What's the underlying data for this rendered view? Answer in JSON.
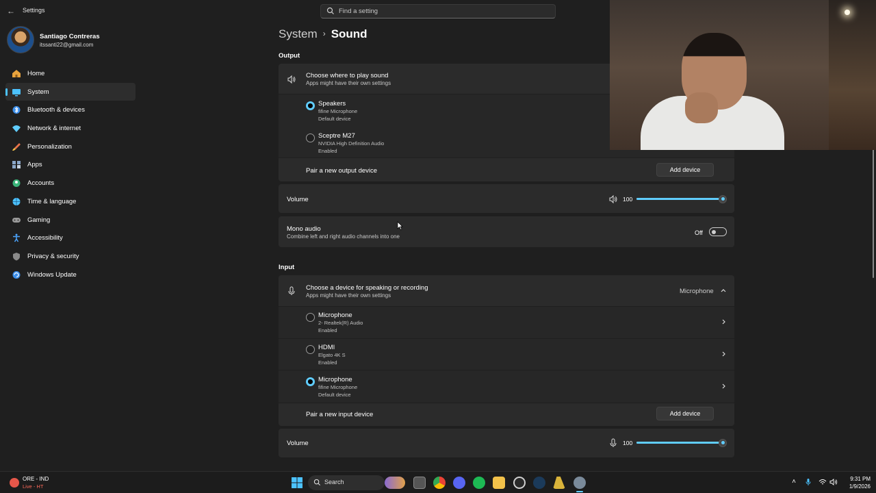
{
  "app": {
    "title": "Settings"
  },
  "search": {
    "placeholder": "Find a setting"
  },
  "profile": {
    "name": "Santiago Contreras",
    "email": "itssanti22@gmail.com"
  },
  "sidebar": {
    "items": [
      {
        "label": "Home",
        "icon": "home-icon",
        "color": "#e8a33d"
      },
      {
        "label": "System",
        "icon": "system-icon",
        "color": "#4cc2ff",
        "active": true
      },
      {
        "label": "Bluetooth & devices",
        "icon": "bluetooth-icon",
        "color": "#3b8eea"
      },
      {
        "label": "Network & internet",
        "icon": "wifi-icon",
        "color": "#60cdff"
      },
      {
        "label": "Personalization",
        "icon": "brush-icon",
        "color": "#e8734a"
      },
      {
        "label": "Apps",
        "icon": "apps-icon",
        "color": "#8aa6c8"
      },
      {
        "label": "Accounts",
        "icon": "accounts-icon",
        "color": "#3bb57a"
      },
      {
        "label": "Time & language",
        "icon": "globe-icon",
        "color": "#4cc2ff"
      },
      {
        "label": "Gaming",
        "icon": "gamepad-icon",
        "color": "#9a9a9a"
      },
      {
        "label": "Accessibility",
        "icon": "accessibility-icon",
        "color": "#4ca5ff"
      },
      {
        "label": "Privacy & security",
        "icon": "shield-icon",
        "color": "#8a8a8a"
      },
      {
        "label": "Windows Update",
        "icon": "update-icon",
        "color": "#3b8eea"
      }
    ]
  },
  "breadcrumb": {
    "parent": "System",
    "separator": "›",
    "current": "Sound"
  },
  "output": {
    "section_label": "Output",
    "chooser_title": "Choose where to play sound",
    "chooser_sub": "Apps might have their own settings",
    "devices": [
      {
        "name": "Speakers",
        "detail": "fifine Microphone",
        "status": "Default device",
        "selected": true
      },
      {
        "name": "Sceptre M27",
        "detail": "NVIDIA High Definition Audio",
        "status": "Enabled",
        "selected": false
      }
    ],
    "pair_label": "Pair a new output device",
    "add_button": "Add device",
    "volume_label": "Volume",
    "volume_value": "100",
    "volume_level": 1.0,
    "mono_title": "Mono audio",
    "mono_sub": "Combine left and right audio channels into one",
    "mono_state": "Off"
  },
  "input": {
    "section_label": "Input",
    "chooser_title": "Choose a device for speaking or recording",
    "chooser_sub": "Apps might have their own settings",
    "current_device": "Microphone",
    "devices": [
      {
        "name": "Microphone",
        "detail": "2- Realtek(R) Audio",
        "status": "Enabled",
        "selected": false
      },
      {
        "name": "HDMI",
        "detail": "Elgato 4K S",
        "status": "Enabled",
        "selected": false
      },
      {
        "name": "Microphone",
        "detail": "fifine Microphone",
        "status": "Default device",
        "selected": true
      }
    ],
    "pair_label": "Pair a new input device",
    "add_button": "Add device",
    "volume_label": "Volume",
    "volume_value": "100",
    "volume_level": 1.0
  },
  "taskbar": {
    "weather_title": "ORE - IND",
    "weather_sub": "Live - HT",
    "search_label": "Search",
    "time": "9:31 PM",
    "date": "1/9/2026"
  },
  "colors": {
    "accent": "#60cdff",
    "background": "#1f1f1f",
    "card": "#2b2b2b"
  }
}
